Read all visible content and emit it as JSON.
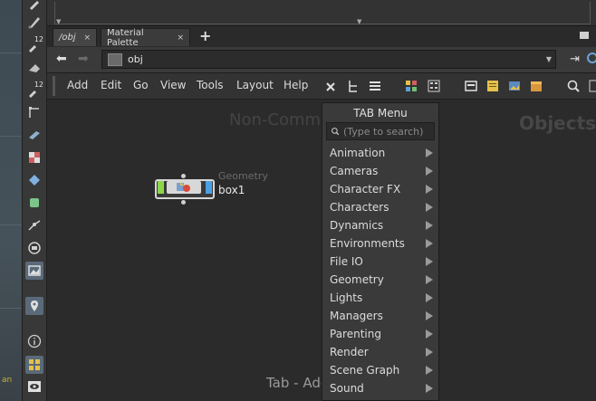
{
  "tabs": [
    {
      "label": "/obj",
      "active": true
    },
    {
      "label": "Material Palette",
      "active": false
    }
  ],
  "path": {
    "value": "obj"
  },
  "menubar": {
    "items": [
      "Add",
      "Edit",
      "Go",
      "View",
      "Tools",
      "Layout",
      "Help"
    ]
  },
  "tool_digits": {
    "a": "12",
    "b": "12"
  },
  "network": {
    "watermark_left": "Non-Comm",
    "watermark_right": "Objects",
    "footer_hint": "Tab - Add",
    "node": {
      "type": "Geometry",
      "name": "box1"
    }
  },
  "tab_menu": {
    "title": "TAB Menu",
    "search_placeholder": "(Type to search)",
    "items": [
      "Animation",
      "Cameras",
      "Character FX",
      "Characters",
      "Dynamics",
      "Environments",
      "File IO",
      "Geometry",
      "Lights",
      "Managers",
      "Parenting",
      "Render",
      "Scene Graph",
      "Sound"
    ]
  },
  "colors": {
    "node_left_flag": "#8cd64a",
    "node_right_flag": "#4aa0e6",
    "accent": "#6aa3d8",
    "background": "#2b2b2b"
  },
  "viewport_text": "an"
}
